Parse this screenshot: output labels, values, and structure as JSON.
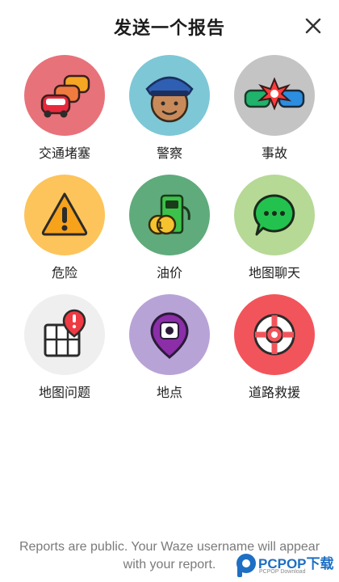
{
  "header": {
    "title": "发送一个报告",
    "close_icon": "close-icon"
  },
  "report_types": [
    {
      "label": "交通堵塞",
      "icon": "traffic-jam-icon",
      "color": "#e8727a"
    },
    {
      "label": "警察",
      "icon": "police-icon",
      "color": "#7ec7d6"
    },
    {
      "label": "事故",
      "icon": "accident-icon",
      "color": "#c4c4c4"
    },
    {
      "label": "危险",
      "icon": "hazard-icon",
      "color": "#fcc45a"
    },
    {
      "label": "油价",
      "icon": "gas-prices-icon",
      "color": "#5fab7c"
    },
    {
      "label": "地图聊天",
      "icon": "map-chat-icon",
      "color": "#b6d996"
    },
    {
      "label": "地图问题",
      "icon": "map-issue-icon",
      "color": "#efefef"
    },
    {
      "label": "地点",
      "icon": "place-icon",
      "color": "#b8a3d6"
    },
    {
      "label": "道路救援",
      "icon": "roadside-help-icon",
      "color": "#f2545b"
    }
  ],
  "footer": {
    "line1": "Reports are public. Your Waze username will appear",
    "line2": "with your report."
  },
  "watermark": {
    "brand": "PCPOP下载",
    "sub": "PCPOP Download"
  }
}
